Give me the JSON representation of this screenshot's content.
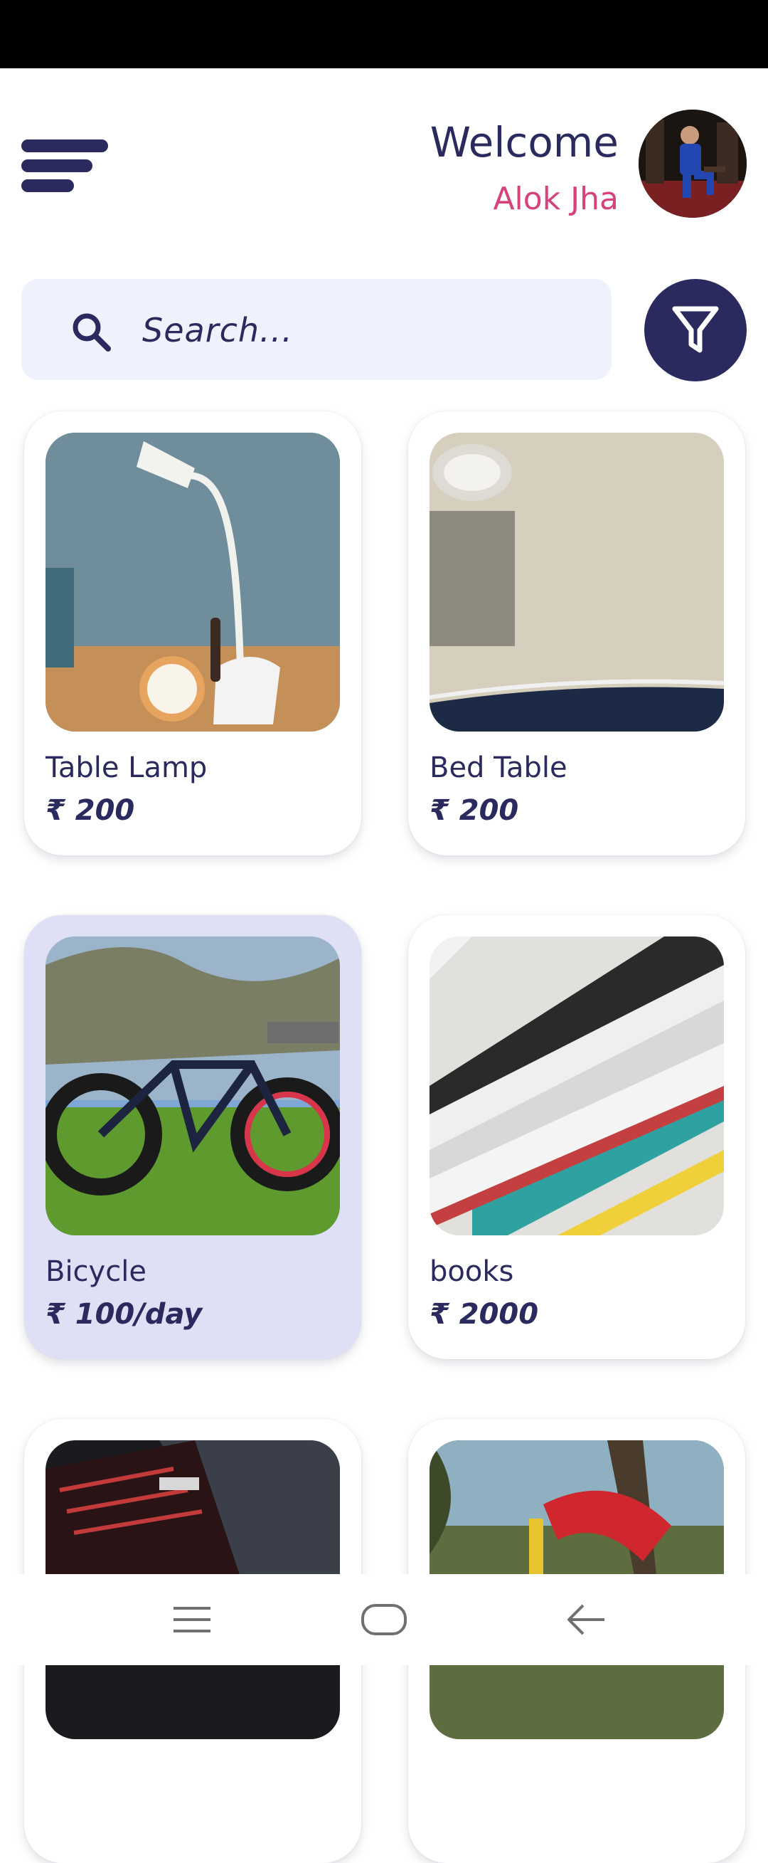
{
  "header": {
    "welcome": "Welcome",
    "username": "Alok Jha",
    "menu_icon": "hamburger-menu-icon",
    "avatar_icon": "user-avatar"
  },
  "search": {
    "placeholder": "Search...",
    "icon": "search-icon"
  },
  "filter": {
    "icon": "filter-icon"
  },
  "products": [
    {
      "title": "Table Lamp",
      "price": "₹ 200",
      "image": "table lamp"
    },
    {
      "title": "Bed Table",
      "price": "₹ 200",
      "image": "bed table"
    },
    {
      "title": "Bicycle",
      "price": "₹ 100/day",
      "image": "bicycle"
    },
    {
      "title": "books",
      "price": "₹ 2000",
      "image": "books"
    },
    {
      "title": "",
      "price": "",
      "image": "laptop"
    },
    {
      "title": "",
      "price": "",
      "image": "playground slide"
    }
  ],
  "colors": {
    "primary": "#2b2a5e",
    "accent": "#d6427c",
    "search_bg": "#eff2fc",
    "selected_card": "#dfe0f5"
  },
  "navbar": {
    "icons": [
      "menu-lines-icon",
      "home-icon",
      "back-arrow-icon"
    ]
  }
}
